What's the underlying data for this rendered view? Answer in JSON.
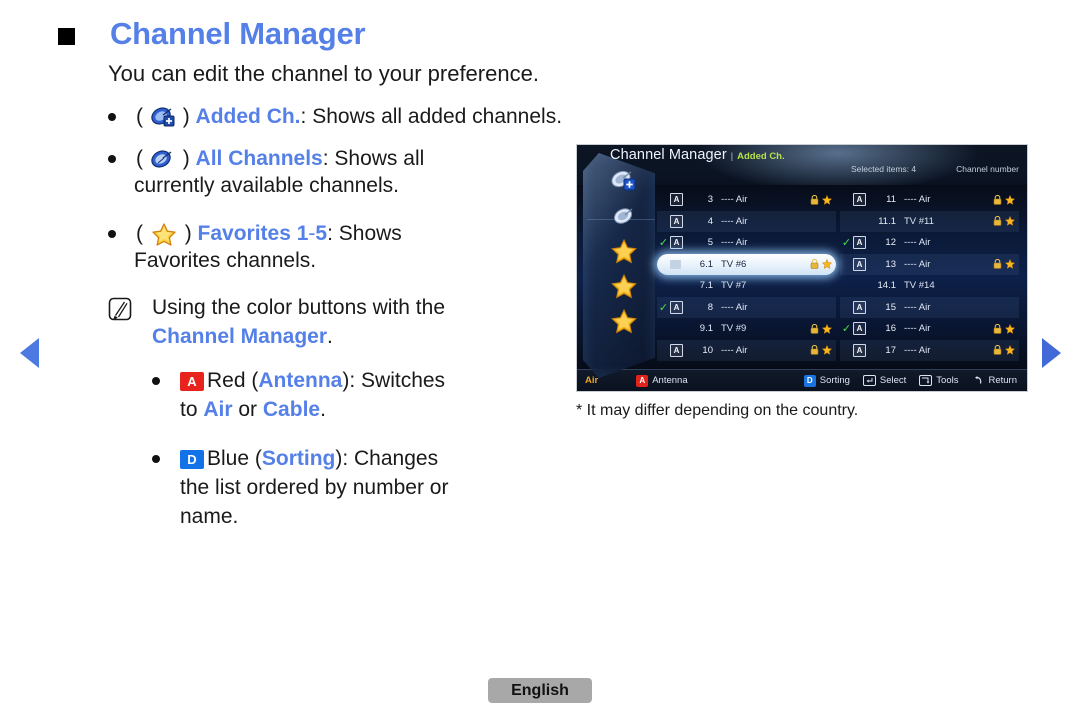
{
  "page": {
    "title": "Channel Manager",
    "intro": "You can edit the channel to your preference.",
    "bullets": [
      {
        "icon": "satellite-dish-add-icon",
        "open_paren": "(",
        "close_paren": ")",
        "term": "Added Ch.",
        "rest": ": Shows all added channels."
      },
      {
        "icon": "satellite-dish-icon",
        "open_paren": "(",
        "close_paren": ")",
        "term": "All Channels",
        "rest": ": Shows all",
        "rest2": "currently available channels."
      },
      {
        "icon": "star-icon",
        "open_paren": "(",
        "close_paren": ")",
        "term": "Favorites 1",
        "term_dash": "-",
        "term2": "5",
        "rest": ": Shows",
        "rest2": "Favorites channels."
      }
    ],
    "note": {
      "icon": "note-pencil-icon",
      "line1": "Using the color buttons with the",
      "line2_link": "Channel Manager",
      "line2_end": ".",
      "items": [
        {
          "key": "A",
          "key_color": "#e8221c",
          "pre": "Red (",
          "link": "Antenna",
          "post": "): Switches",
          "line2_pre": "to ",
          "line2_link1": "Air",
          "line2_mid": " or ",
          "line2_link2": "Cable",
          "line2_end": "."
        },
        {
          "key": "D",
          "key_color": "#1273e8",
          "pre": "Blue (",
          "link": "Sorting",
          "post": "): Changes",
          "line2": "the list ordered by number or",
          "line3": "name."
        }
      ]
    },
    "caption": "* It may differ depending on the country.",
    "language_button": "English",
    "nav": {
      "prev_icon": "arrow-left-icon",
      "next_icon": "arrow-right-icon"
    }
  },
  "tv_screen": {
    "header": {
      "title": "Channel Manager",
      "separator": "|",
      "tab": "Added Ch.",
      "selected_items": "Selected items: 4",
      "sort_mode": "Channel number"
    },
    "sidebar": [
      {
        "icon": "satellite-dish-add-icon",
        "name": "added-channels",
        "selected": true
      },
      {
        "icon": "satellite-dish-icon",
        "name": "all-channels",
        "selected": false
      },
      {
        "icon": "star-icon",
        "name": "favorites-1",
        "selected": false
      },
      {
        "icon": "star-icon",
        "name": "favorites-2",
        "selected": false
      },
      {
        "icon": "star-icon",
        "name": "favorites-3",
        "selected": false
      }
    ],
    "columns": [
      {
        "rows": [
          {
            "check": false,
            "antenna": true,
            "number": "3",
            "name": "---- Air",
            "lock": true,
            "fav": true,
            "selected": false
          },
          {
            "check": false,
            "antenna": true,
            "number": "4",
            "name": "---- Air",
            "lock": false,
            "fav": false,
            "selected": false
          },
          {
            "check": true,
            "antenna": true,
            "number": "5",
            "name": "---- Air",
            "lock": false,
            "fav": false,
            "selected": false
          },
          {
            "check": false,
            "antenna": false,
            "number": "6.1",
            "name": "TV #6",
            "lock": true,
            "fav": true,
            "selected": true
          },
          {
            "check": false,
            "antenna": false,
            "number": "7.1",
            "name": "TV #7",
            "lock": false,
            "fav": false,
            "selected": false
          },
          {
            "check": true,
            "antenna": true,
            "number": "8",
            "name": "---- Air",
            "lock": false,
            "fav": false,
            "selected": false
          },
          {
            "check": false,
            "antenna": false,
            "number": "9.1",
            "name": "TV #9",
            "lock": true,
            "fav": true,
            "selected": false
          },
          {
            "check": false,
            "antenna": true,
            "number": "10",
            "name": "---- Air",
            "lock": true,
            "fav": true,
            "selected": false
          }
        ]
      },
      {
        "rows": [
          {
            "check": false,
            "antenna": true,
            "number": "11",
            "name": "---- Air",
            "lock": true,
            "fav": true,
            "selected": false
          },
          {
            "check": false,
            "antenna": false,
            "number": "11.1",
            "name": "TV #11",
            "lock": true,
            "fav": true,
            "selected": false
          },
          {
            "check": true,
            "antenna": true,
            "number": "12",
            "name": "---- Air",
            "lock": false,
            "fav": false,
            "selected": false
          },
          {
            "check": false,
            "antenna": true,
            "number": "13",
            "name": "---- Air",
            "lock": true,
            "fav": true,
            "selected": false
          },
          {
            "check": false,
            "antenna": false,
            "number": "14.1",
            "name": "TV #14",
            "lock": false,
            "fav": false,
            "selected": false
          },
          {
            "check": false,
            "antenna": true,
            "number": "15",
            "name": "---- Air",
            "lock": false,
            "fav": false,
            "selected": false
          },
          {
            "check": true,
            "antenna": true,
            "number": "16",
            "name": "---- Air",
            "lock": true,
            "fav": true,
            "selected": false
          },
          {
            "check": false,
            "antenna": true,
            "number": "17",
            "name": "---- Air",
            "lock": true,
            "fav": true,
            "selected": false
          }
        ]
      }
    ],
    "footer": {
      "air": "Air",
      "antenna_key": "A",
      "antenna_label": "Antenna",
      "sorting_key": "D",
      "sorting_label": "Sorting",
      "select_label": "Select",
      "tools_label": "Tools",
      "return_label": "Return"
    }
  },
  "colors": {
    "link_blue": "#5580e8",
    "red_key": "#e8221c",
    "blue_key": "#1273e8",
    "tab_green": "#b8e24a",
    "air_orange": "#f0a41e",
    "check_green": "#49e04a",
    "star_gold": "#f5b41c"
  }
}
